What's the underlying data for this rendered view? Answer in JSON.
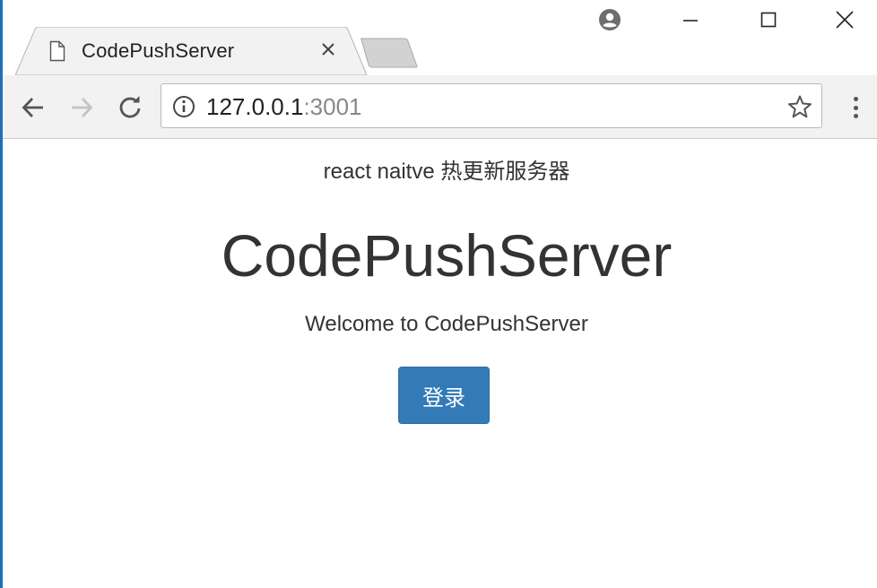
{
  "window": {
    "controls": {
      "minimize": "minimize-icon",
      "maximize": "maximize-icon",
      "close": "close-icon"
    },
    "profile_icon": "account-circle-icon"
  },
  "tab": {
    "title": "CodePushServer",
    "icon": "document-icon",
    "close_icon": "close-icon"
  },
  "toolbar": {
    "back_icon": "arrow-left-icon",
    "forward_icon": "arrow-right-icon",
    "reload_icon": "reload-icon",
    "address": {
      "host": "127.0.0.1",
      "port": ":3001",
      "info_icon": "info-icon"
    },
    "bookmark_icon": "star-icon",
    "menu_icon": "more-vertical-icon"
  },
  "page": {
    "subtitle": "react naitve 热更新服务器",
    "title": "CodePushServer",
    "welcome": "Welcome to CodePushServer",
    "login_label": "登录",
    "accent": "#337ab7"
  }
}
